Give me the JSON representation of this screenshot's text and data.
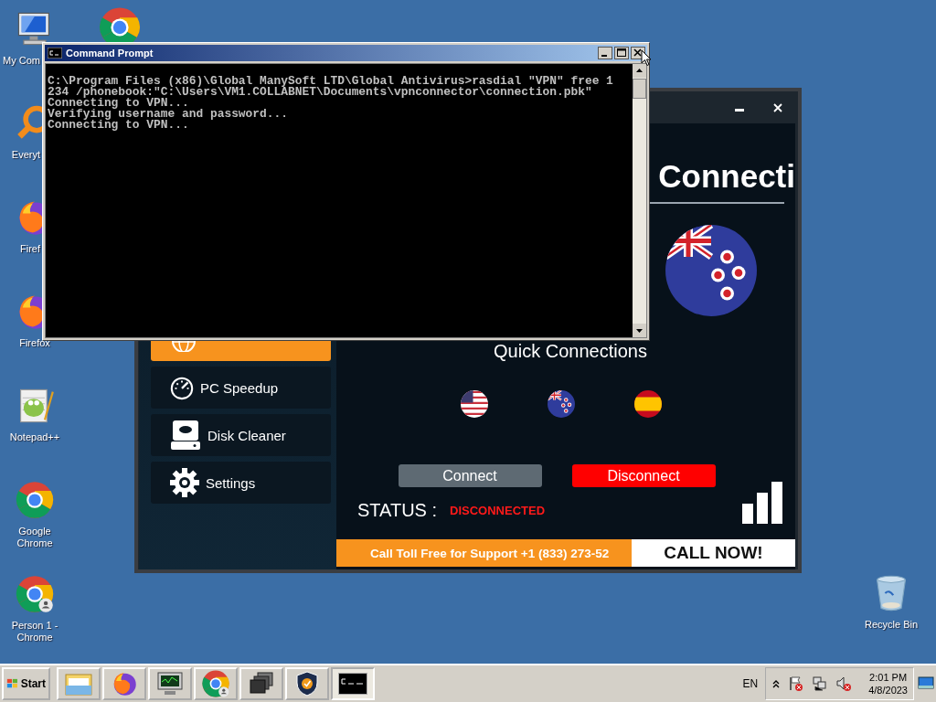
{
  "desktop": {
    "left_column": [
      {
        "kind": "computer",
        "label": "My Com",
        "cut": true
      },
      {
        "kind": "finder",
        "label": "Everyt",
        "cut": true
      },
      {
        "kind": "firefox",
        "label": "Firef",
        "cut": true
      },
      {
        "kind": "firefox",
        "label": "Firefox",
        "cut": false
      },
      {
        "kind": "notepad",
        "label": "Notepad++",
        "cut": false
      },
      {
        "kind": "chrome",
        "label": "Google Chrome",
        "cut": false
      },
      {
        "kind": "profile",
        "label": "Person 1 - Chrome",
        "cut": false
      }
    ],
    "second_column": [
      {
        "kind": "chrome"
      }
    ],
    "right_column": [
      {
        "kind": "trash",
        "label": "Recycle Bin",
        "cut": false
      }
    ]
  },
  "vpn_window": {
    "sidebar": {
      "items": [
        {
          "kind": "globe",
          "selected": true
        },
        {
          "kind": "gauge",
          "label": "PC Speedup",
          "selected": false
        },
        {
          "kind": "disk",
          "label": "Disk Cleaner",
          "selected": false
        },
        {
          "kind": "gear",
          "label": "Settings",
          "selected": false
        }
      ]
    },
    "heading": "Connecti",
    "current_flag": {
      "kind": "nz"
    },
    "quick_title": "Quick Connections",
    "quick_flags": [
      {
        "kind": "us"
      },
      {
        "kind": "nz"
      },
      {
        "kind": "es"
      }
    ],
    "buttons": [
      {
        "label": "Connect",
        "kind": "connect"
      },
      {
        "label": "Disconnect",
        "kind": "disconnect"
      }
    ],
    "status": {
      "label": "STATUS :",
      "value": "DISCONNECTED",
      "connected": false
    },
    "banner": {
      "text": "Call Toll Free for Support +1 (833) 273-52",
      "action": "CALL NOW!"
    }
  },
  "cmd_window": {
    "title": "Command Prompt",
    "lines": [
      "C:\\Program Files (x86)\\Global ManySoft LTD\\Global Antivirus>rasdial \"VPN\" free 1",
      "234 /phonebook:\"C:\\Users\\VM1.COLLABNET\\Documents\\vpnconnector\\connection.pbk\"",
      "Connecting to VPN...",
      "Verifying username and password...",
      "Connecting to VPN..."
    ]
  },
  "taskbar": {
    "start": "Start",
    "items": [
      {
        "kind": "folder",
        "selected": false
      },
      {
        "kind": "firefox",
        "selected": false
      },
      {
        "kind": "monitor",
        "selected": false
      },
      {
        "kind": "profile",
        "selected": false
      },
      {
        "kind": "windows",
        "selected": false
      },
      {
        "kind": "shield",
        "selected": false
      },
      {
        "kind": "console",
        "selected": true
      }
    ],
    "language": "EN",
    "time": "2:01 PM",
    "date": "4/8/2023"
  }
}
